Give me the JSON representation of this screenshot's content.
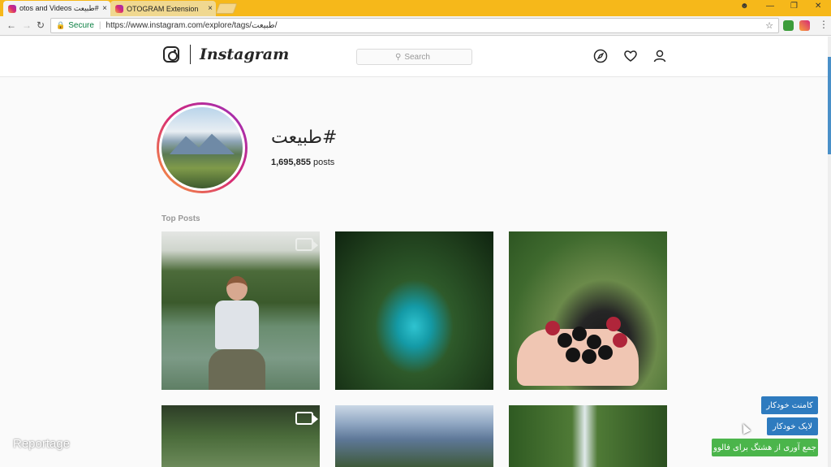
{
  "browser": {
    "tabs": [
      {
        "title": "otos and Videos طبیعت#",
        "active": true
      },
      {
        "title": "OTOGRAM Extension",
        "active": false
      }
    ],
    "close_glyph": "×",
    "address": {
      "secure_label": "Secure",
      "url": "https://www.instagram.com/explore/tags/طبیعت/"
    }
  },
  "instagram": {
    "wordmark": "Instagram",
    "search_placeholder": "Search",
    "tag_title": "طبیعت#",
    "post_count": "1,695,855",
    "post_count_suffix": "posts",
    "section_label": "Top Posts"
  },
  "extension_buttons": {
    "auto_comment": "کامنت خودکار",
    "auto_like": "لایک خودکار",
    "collect_followers": "جمع آوری از هشتگ برای فالوو"
  },
  "watermark": "Reportage"
}
